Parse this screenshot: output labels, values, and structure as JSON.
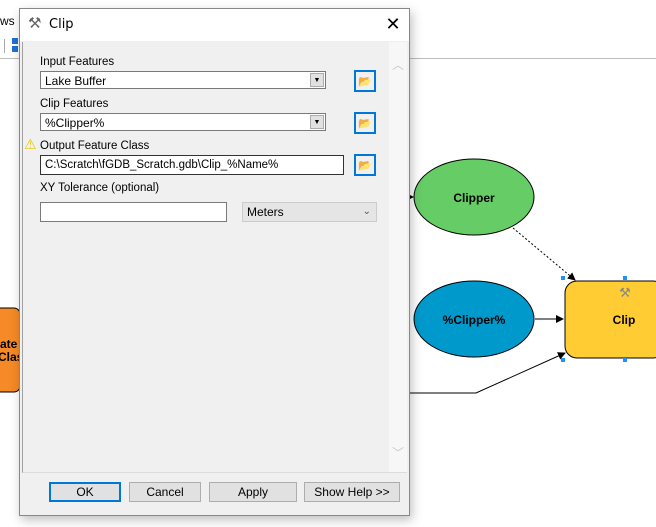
{
  "background": {
    "menu_fragment": "ws",
    "diagram": {
      "nodes": [
        {
          "label": "Clipper",
          "shape": "ellipse",
          "color": "#66cc66"
        },
        {
          "label": "%Clipper%",
          "shape": "ellipse",
          "color": "#0099cc"
        },
        {
          "label": "Clip",
          "shape": "rounded-rect",
          "color": "#ffcc33"
        },
        {
          "label_lines": [
            "ate",
            "Clas"
          ],
          "shape": "rounded-rect",
          "color": "#f58a26"
        }
      ]
    }
  },
  "dialog": {
    "title": "Clip",
    "icon": "hammer-icon",
    "close_icon": "close-icon",
    "fields": {
      "input_features": {
        "label": "Input Features",
        "value": "Lake Buffer"
      },
      "clip_features": {
        "label": "Clip Features",
        "value": "%Clipper%"
      },
      "output_feature_class": {
        "label": "Output Feature Class",
        "value": "C:\\Scratch\\fGDB_Scratch.gdb\\Clip_%Name%",
        "warning_icon": "warning-icon"
      },
      "xy_tolerance": {
        "label": "XY Tolerance (optional)",
        "value": "",
        "unit": "Meters"
      }
    },
    "buttons": {
      "ok": "OK",
      "cancel": "Cancel",
      "apply": "Apply",
      "show_help": "Show Help >>"
    },
    "accent": "#0078d7"
  }
}
